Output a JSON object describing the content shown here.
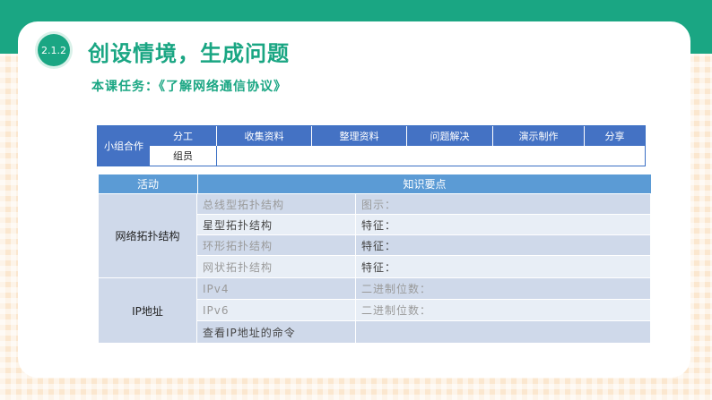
{
  "header": {
    "badge": "2.1.2",
    "title": "创设情境，生成问题",
    "task": "本课任务：《了解网络通信协议》"
  },
  "group_table": {
    "lead": "小组合作",
    "headers": [
      "分工",
      "收集资料",
      "整理资料",
      "问题解决",
      "演示制作",
      "分享"
    ],
    "row_label": "组员"
  },
  "main_table": {
    "headers": [
      "活动",
      "知识要点"
    ],
    "groups": [
      {
        "name": "网络拓扑结构",
        "rows": [
          [
            "总线型拓扑结构",
            "图示："
          ],
          [
            "星型拓扑结构",
            "特征："
          ],
          [
            "环形拓扑结构",
            "特征："
          ],
          [
            "网状拓扑结构",
            "特征："
          ]
        ]
      },
      {
        "name": "IP地址",
        "rows": [
          [
            "IPv4",
            "二进制位数："
          ],
          [
            "IPv6",
            "二进制位数："
          ],
          [
            "查看IP地址的命令",
            ""
          ]
        ]
      }
    ]
  },
  "colors": {
    "accent_green": "#1aa683",
    "table_blue": "#4472c4",
    "header_blue": "#5b9bd5",
    "row_dark": "#cfd9ea",
    "row_light": "#e8eef6"
  }
}
